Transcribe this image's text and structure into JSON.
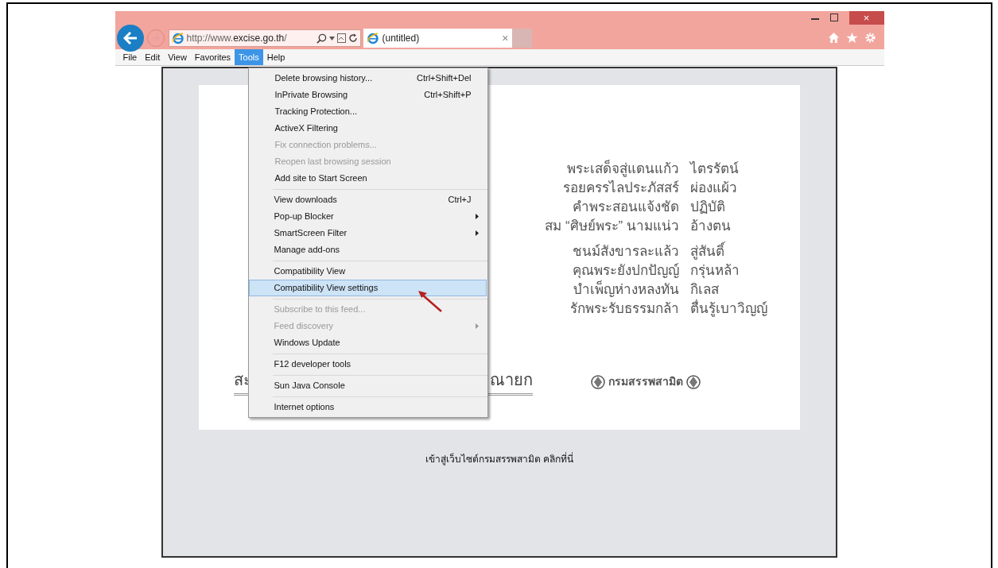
{
  "address_bar": {
    "url_prefix": "http://www.",
    "url_domain": "excise.go.th",
    "url_suffix": "/"
  },
  "tab": {
    "title": "(untitled)",
    "close": "×"
  },
  "window_controls": {
    "close": "×"
  },
  "menu_bar": [
    {
      "label": "File",
      "selected": false
    },
    {
      "label": "Edit",
      "selected": false
    },
    {
      "label": "View",
      "selected": false
    },
    {
      "label": "Favorites",
      "selected": false
    },
    {
      "label": "Tools",
      "selected": true
    },
    {
      "label": "Help",
      "selected": false
    }
  ],
  "tools_menu": [
    [
      {
        "label": "Delete browsing history...",
        "shortcut": "Ctrl+Shift+Del",
        "disabled": false,
        "submenu": false,
        "selected": false
      },
      {
        "label": "InPrivate Browsing",
        "shortcut": "Ctrl+Shift+P",
        "disabled": false,
        "submenu": false,
        "selected": false
      },
      {
        "label": "Tracking Protection...",
        "disabled": false,
        "submenu": false,
        "selected": false
      },
      {
        "label": "ActiveX Filtering",
        "disabled": false,
        "submenu": false,
        "selected": false
      },
      {
        "label": "Fix connection problems...",
        "disabled": true,
        "submenu": false,
        "selected": false
      },
      {
        "label": "Reopen last browsing session",
        "disabled": true,
        "submenu": false,
        "selected": false
      },
      {
        "label": "Add site to Start Screen",
        "disabled": false,
        "submenu": false,
        "selected": false
      }
    ],
    [
      {
        "label": "View downloads",
        "shortcut": "Ctrl+J",
        "disabled": false,
        "submenu": false,
        "selected": false
      },
      {
        "label": "Pop-up Blocker",
        "disabled": false,
        "submenu": true,
        "selected": false
      },
      {
        "label": "SmartScreen Filter",
        "disabled": false,
        "submenu": true,
        "selected": false
      },
      {
        "label": "Manage add-ons",
        "disabled": false,
        "submenu": false,
        "selected": false
      }
    ],
    [
      {
        "label": "Compatibility View",
        "disabled": false,
        "submenu": false,
        "selected": false
      },
      {
        "label": "Compatibility View settings",
        "disabled": false,
        "submenu": false,
        "selected": true
      }
    ],
    [
      {
        "label": "Subscribe to this feed...",
        "disabled": true,
        "submenu": false,
        "selected": false
      },
      {
        "label": "Feed discovery",
        "disabled": true,
        "submenu": true,
        "selected": false
      },
      {
        "label": "Windows Update",
        "disabled": false,
        "submenu": false,
        "selected": false
      }
    ],
    [
      {
        "label": "F12 developer tools",
        "disabled": false,
        "submenu": false,
        "selected": false
      }
    ],
    [
      {
        "label": "Sun Java Console",
        "disabled": false,
        "submenu": false,
        "selected": false
      }
    ],
    [
      {
        "label": "Internet options",
        "disabled": false,
        "submenu": false,
        "selected": false
      }
    ]
  ],
  "poem": [
    [
      [
        "พระเสด็จสู่แดนแก้ว",
        "ไตรรัตน์"
      ],
      [
        "รอยครรไลประภัสสร์",
        "ผ่องแผ้ว"
      ],
      [
        "คำพระสอนแจ้งชัด",
        "ปฏิบัติ"
      ],
      [
        "สม “ศิษย์พระ” นามแน่ว",
        "อ้างตน"
      ]
    ],
    [
      [
        "ชนม์สังขารละแล้ว",
        "สู่สันติ์"
      ],
      [
        "คุณพระยังปกปัญญ์",
        "กรุ่นหล้า"
      ],
      [
        "บำเพ็ญห่างหลงทัน",
        "กิเลส"
      ],
      [
        "รักพระรับธรรมกล้า",
        "ตื่นรู้เบาวิญญ์"
      ]
    ]
  ],
  "banner_heading": {
    "left": "สะ",
    "right": "ณายก"
  },
  "banner_logo": "กรมสรรพสามิต",
  "enter_link": "เข้าสู่เว็บไซต์กรมสรรพสามิต คลิกที่นี่"
}
